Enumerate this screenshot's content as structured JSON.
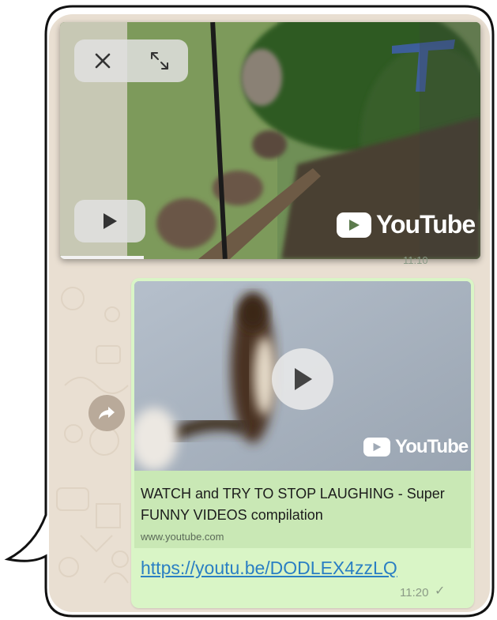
{
  "pip_player": {
    "close_icon": "close-icon",
    "expand_icon": "expand-icon",
    "play_icon": "play-icon",
    "brand": "YouTube",
    "progress": 0.2
  },
  "previous_message": {
    "time": "11:10"
  },
  "message": {
    "thumbnail_brand": "YouTube",
    "title": "WATCH and TRY TO STOP LAUGHING - Super FUNNY VIDEOS compilation",
    "domain": "www.youtube.com",
    "url": "https://youtu.be/DODLEX4zzLQ",
    "time": "11:20",
    "status_icon": "single-check-icon",
    "status_glyph": "✓"
  },
  "forward_icon": "forward-icon",
  "colors": {
    "chat_background": "#e9dfd2",
    "outgoing_bubble": "#d9f5c6",
    "link_preview": "#c9e8b5",
    "link": "#2a7fc3"
  }
}
